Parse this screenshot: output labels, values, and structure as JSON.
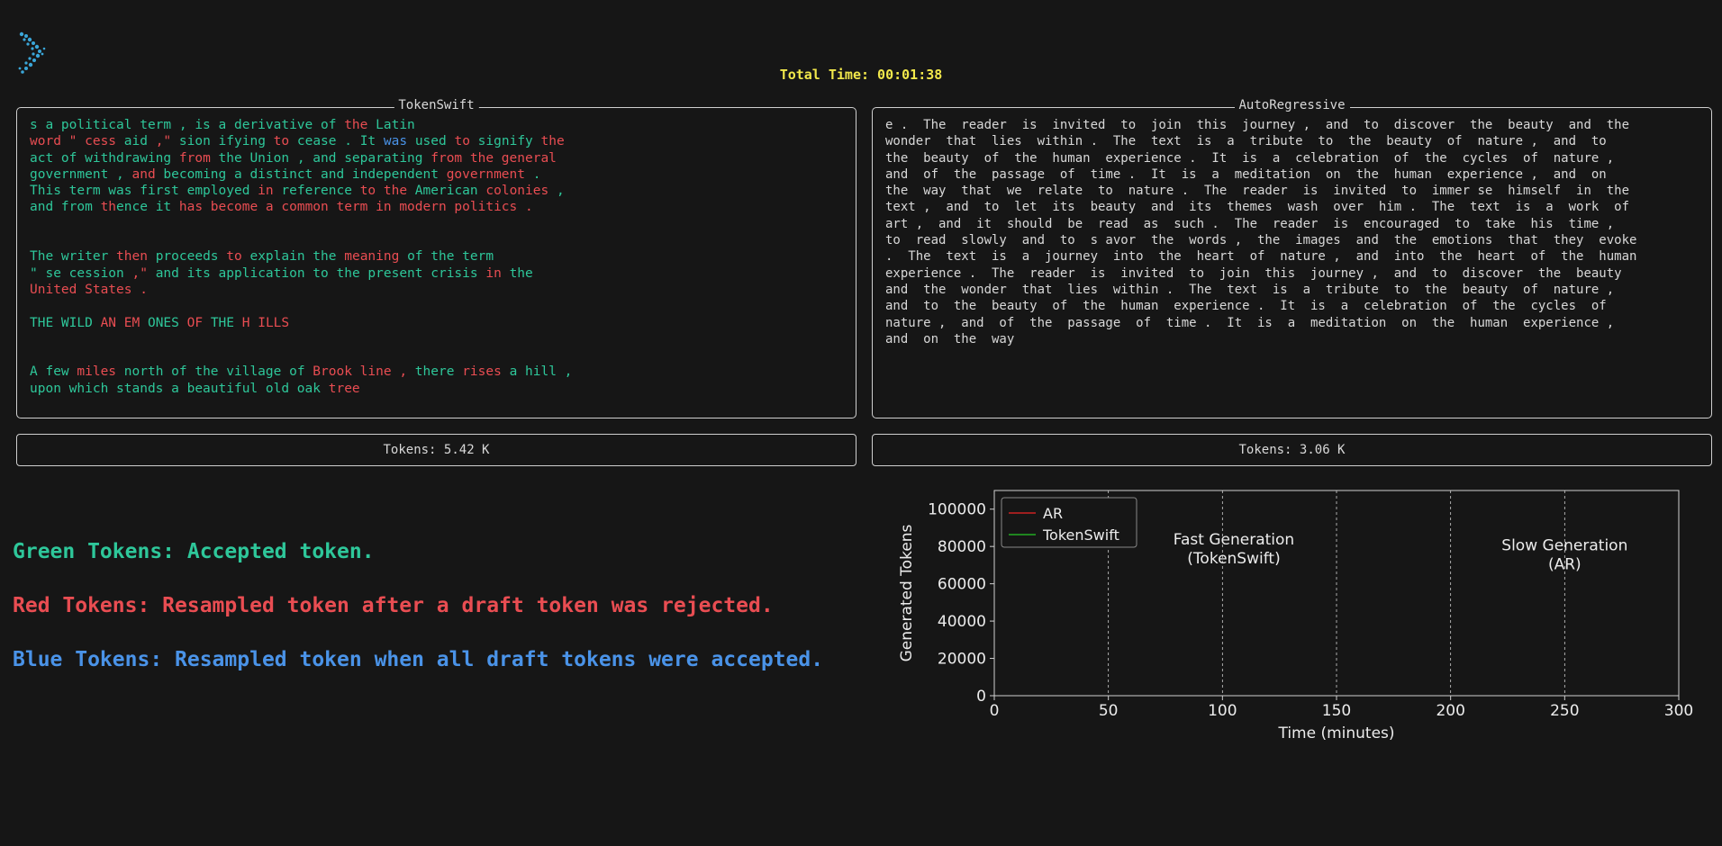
{
  "header": {
    "total_time": "Total Time: 00:01:38",
    "logo_icon": "tokenswift-logo-icon"
  },
  "panels": {
    "tokenswift": {
      "title": "TokenSwift",
      "lines": [
        [
          [
            "s a political term , is a derivative of ",
            "green"
          ],
          [
            "the ",
            "red"
          ],
          [
            "Latin",
            "green"
          ]
        ],
        [
          [
            "word \" cess ",
            "red"
          ],
          [
            "aid",
            "green"
          ],
          [
            " ,\" ",
            "red"
          ],
          [
            "sion ifying ",
            "green"
          ],
          [
            "to ",
            "red"
          ],
          [
            "cease . It ",
            "green"
          ],
          [
            "was ",
            "blue"
          ],
          [
            "used ",
            "green"
          ],
          [
            "to ",
            "red"
          ],
          [
            "signify ",
            "green"
          ],
          [
            "the",
            "red"
          ]
        ],
        [
          [
            "act of withdrawing ",
            "green"
          ],
          [
            "from ",
            "red"
          ],
          [
            "the Union , and separating ",
            "green"
          ],
          [
            "from the general",
            "red"
          ]
        ],
        [
          [
            "government , ",
            "green"
          ],
          [
            "and ",
            "red"
          ],
          [
            "becoming a distinct and independent ",
            "green"
          ],
          [
            "government",
            "red"
          ],
          [
            " .",
            "green"
          ]
        ],
        [
          [
            "This term was first employed ",
            "green"
          ],
          [
            "in ",
            "red"
          ],
          [
            "reference ",
            "green"
          ],
          [
            "to the ",
            "red"
          ],
          [
            "American ",
            "green"
          ],
          [
            "colonies",
            "red"
          ],
          [
            " ,",
            "green"
          ]
        ],
        [
          [
            "and from ",
            "green"
          ],
          [
            "th",
            "red"
          ],
          [
            "ence it ",
            "green"
          ],
          [
            "has become a common term in modern politics .",
            "red"
          ]
        ],
        [
          [
            "",
            "green"
          ]
        ],
        [
          [
            "",
            "green"
          ]
        ],
        [
          [
            "The writer ",
            "green"
          ],
          [
            "then ",
            "red"
          ],
          [
            "proceeds ",
            "green"
          ],
          [
            "to ",
            "red"
          ],
          [
            "explain the ",
            "green"
          ],
          [
            "meaning ",
            "red"
          ],
          [
            "of the term",
            "green"
          ]
        ],
        [
          [
            "\" se cession ",
            "green"
          ],
          [
            ",\" ",
            "red"
          ],
          [
            "and its application to the present crisis ",
            "green"
          ],
          [
            "in ",
            "red"
          ],
          [
            "the",
            "green"
          ]
        ],
        [
          [
            "United States .",
            "red"
          ]
        ],
        [
          [
            "",
            "green"
          ]
        ],
        [
          [
            "THE WILD ",
            "green"
          ],
          [
            "AN EM ",
            "red"
          ],
          [
            "ONES ",
            "green"
          ],
          [
            "OF ",
            "red"
          ],
          [
            "THE ",
            "green"
          ],
          [
            "H ILLS",
            "red"
          ]
        ],
        [
          [
            "",
            "green"
          ]
        ],
        [
          [
            "",
            "green"
          ]
        ],
        [
          [
            "A few ",
            "green"
          ],
          [
            "miles ",
            "red"
          ],
          [
            "north of the village of ",
            "green"
          ],
          [
            "Brook line , ",
            "red"
          ],
          [
            "there ",
            "green"
          ],
          [
            "rises ",
            "red"
          ],
          [
            "a hill ,",
            "green"
          ]
        ],
        [
          [
            "upon which stands a beautiful old oak ",
            "green"
          ],
          [
            "tree",
            "red"
          ]
        ]
      ]
    },
    "autoregressive": {
      "title": "AutoRegressive",
      "lines": [
        "e .  The  reader  is  invited  to  join  this  journey ,  and  to  discover  the  beauty  and  the",
        "wonder  that  lies  within .  The  text  is  a  tribute  to  the  beauty  of  nature ,  and  to",
        "the  beauty  of  the  human  experience .  It  is  a  celebration  of  the  cycles  of  nature ,",
        "and  of  the  passage  of  time .  It  is  a  meditation  on  the  human  experience ,  and  on",
        "the  way  that  we  relate  to  nature .  The  reader  is  invited  to  immer se  himself  in  the",
        "text ,  and  to  let  its  beauty  and  its  themes  wash  over  him .  The  text  is  a  work  of",
        "art ,  and  it  should  be  read  as  such .  The  reader  is  encouraged  to  take  his  time ,",
        "to  read  slowly  and  to  s avor  the  words ,  the  images  and  the  emotions  that  they  evoke",
        ".  The  text  is  a  journey  into  the  heart  of  nature ,  and  into  the  heart  of  the  human",
        "experience .  The  reader  is  invited  to  join  this  journey ,  and  to  discover  the  beauty",
        "and  the  wonder  that  lies  within .  The  text  is  a  tribute  to  the  beauty  of  nature ,",
        "and  to  the  beauty  of  the  human  experience .  It  is  a  celebration  of  the  cycles  of",
        "nature ,  and  of  the  passage  of  time .  It  is  a  meditation  on  the  human  experience ,",
        "and  on  the  way"
      ]
    }
  },
  "counters": {
    "tokenswift": "Tokens: 5.42 K",
    "autoregressive": "Tokens: 3.06 K"
  },
  "legend_text": {
    "green": "Green Tokens: Accepted token.",
    "red": "Red Tokens: Resampled token after a draft token was rejected.",
    "blue": "Blue Tokens: Resampled token when all draft tokens were accepted."
  },
  "colors": {
    "green": "#2ec79a",
    "red": "#e94d52",
    "blue": "#4a93e8",
    "yellow": "#f2e84b",
    "background": "#161616"
  },
  "chart_data": {
    "type": "line",
    "xlabel": "Time (minutes)",
    "ylabel": "Generated Tokens",
    "xlim": [
      0,
      300
    ],
    "ylim": [
      0,
      110000
    ],
    "xticks": [
      0,
      50,
      100,
      150,
      200,
      250,
      300
    ],
    "yticks": [
      0,
      20000,
      40000,
      60000,
      80000,
      100000
    ],
    "vlines": [
      50,
      100,
      150,
      200,
      250
    ],
    "series": [
      {
        "name": "AR",
        "color": "#cc2222",
        "x": [
          0
        ],
        "y": [
          0
        ]
      },
      {
        "name": "TokenSwift",
        "color": "#22aa22",
        "x": [
          0
        ],
        "y": [
          0
        ]
      }
    ],
    "annotations": [
      {
        "text": [
          "Fast Generation",
          "(TokenSwift)"
        ],
        "x": 105,
        "y": 81000
      },
      {
        "text": [
          "Slow Generation",
          "(AR)"
        ],
        "x": 250,
        "y": 78000
      }
    ],
    "legend_loc": "upper left",
    "grid": false
  }
}
